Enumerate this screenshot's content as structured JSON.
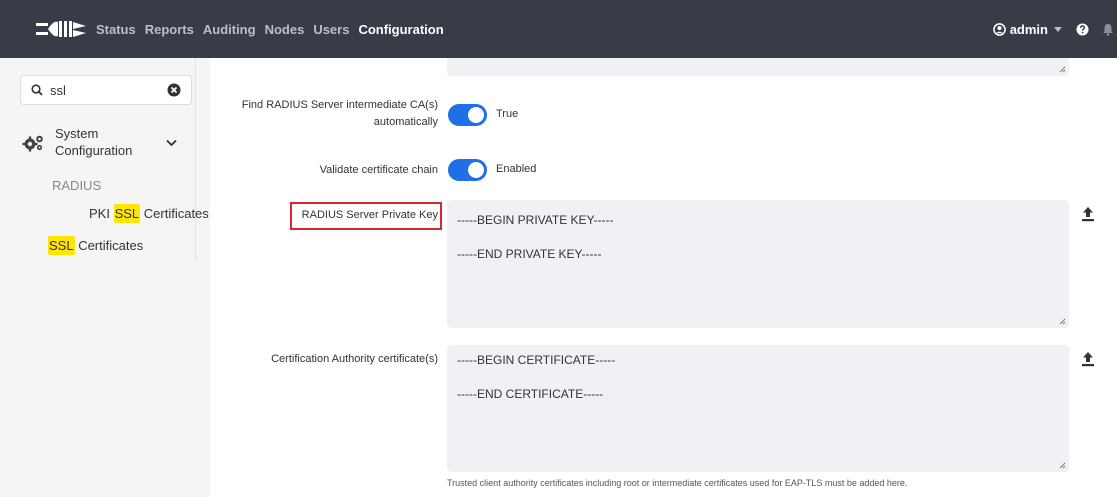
{
  "nav": {
    "items": [
      "Status",
      "Reports",
      "Auditing",
      "Nodes",
      "Users",
      "Configuration"
    ],
    "active": "Configuration",
    "user": "admin"
  },
  "sidebar": {
    "search": {
      "value": "ssl",
      "placeholder": "Filter"
    },
    "section": {
      "line1": "System",
      "line2": "Configuration"
    },
    "radius_label": "RADIUS",
    "pki_item": {
      "before": "PKI ",
      "highlight": "SSL",
      "after": " Certificates"
    },
    "ssl_item": {
      "highlight": "SSL",
      "after": " Certificates"
    }
  },
  "form": {
    "find_ca": {
      "label_line1": "Find RADIUS Server intermediate CA(s)",
      "label_line2": "automatically",
      "state": "True"
    },
    "validate_chain": {
      "label": "Validate certificate chain",
      "state": "Enabled"
    },
    "private_key": {
      "label": "RADIUS Server Private Key",
      "line1": "-----BEGIN PRIVATE KEY-----",
      "line2": "-----END PRIVATE KEY-----"
    },
    "ca_cert": {
      "label": "Certification Authority certificate(s)",
      "line1": "-----BEGIN CERTIFICATE-----",
      "line2": "-----END CERTIFICATE-----",
      "help": "Trusted client authority certificates including root or intermediate certificates used for EAP-TLS must be added here."
    }
  },
  "colors": {
    "navbar": "#373c47",
    "accent": "#1f70e6",
    "highlight": "#ffe600",
    "callout": "#d9252b"
  },
  "icons": [
    "logo-icon",
    "user-circle-icon",
    "help-icon",
    "bell-icon",
    "search-icon",
    "clear-icon",
    "gears-icon",
    "chevron-down-icon",
    "upload-icon",
    "resize-grip-icon"
  ]
}
